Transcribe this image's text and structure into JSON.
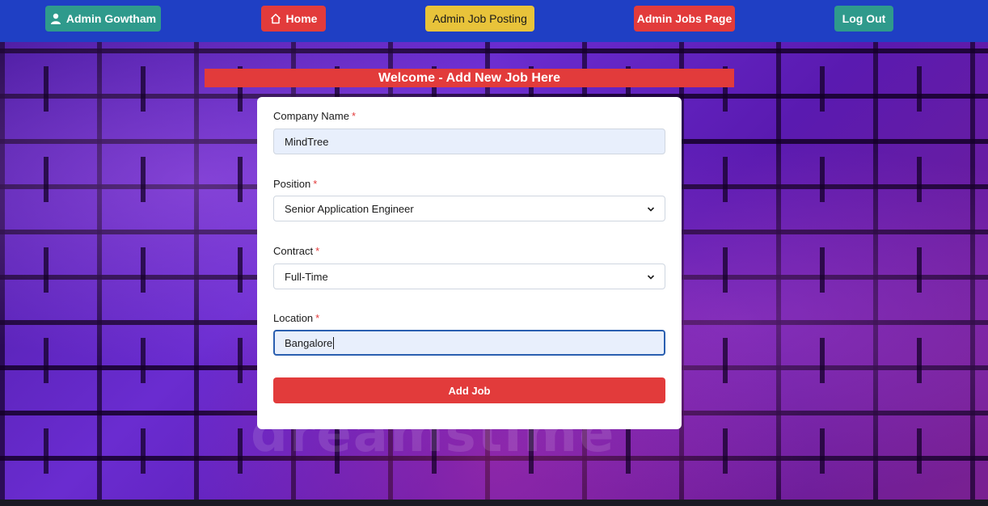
{
  "navbar": {
    "admin_label": "Admin Gowtham",
    "admin_icon": "user-icon",
    "home_label": "Home",
    "home_icon": "home-icon",
    "post_label": "Admin Job Posting",
    "jobs_label": "Admin Jobs Page",
    "logout_label": "Log Out"
  },
  "banner": {
    "title": "Welcome - Add New Job Here"
  },
  "form": {
    "required_mark": "*",
    "company": {
      "label": "Company Name",
      "value": "MindTree"
    },
    "position": {
      "label": "Position",
      "value": "Senior Application Engineer"
    },
    "contract": {
      "label": "Contract",
      "value": "Full-Time"
    },
    "location": {
      "label": "Location",
      "value": "Bangalore"
    },
    "submit_label": "Add Job"
  },
  "colors": {
    "navbar": "#1f3fc4",
    "teal": "#2f9a8c",
    "red": "#e23b3b",
    "yellow": "#e8c33a"
  }
}
